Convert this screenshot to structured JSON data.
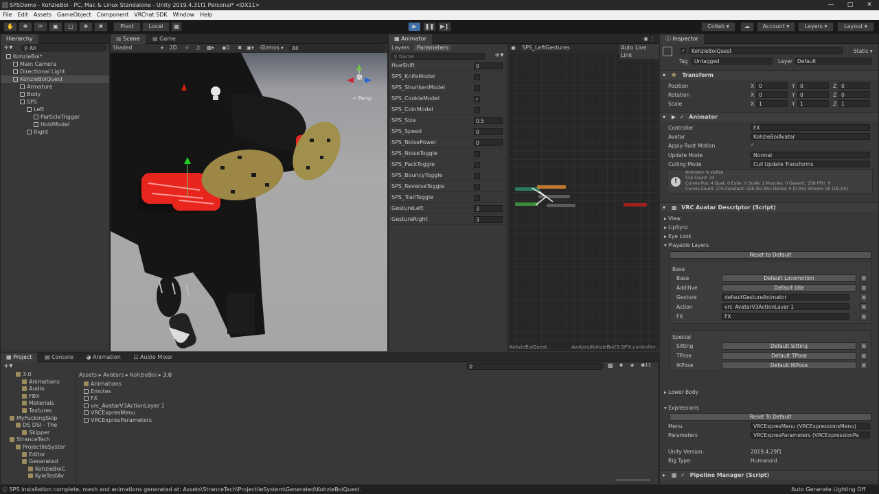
{
  "window": {
    "title": "SPSDemo - KohzieBoi - PC, Mac & Linux Standalone - Unity 2019.4.31f1 Personal* <DX11>"
  },
  "menu": [
    "File",
    "Edit",
    "Assets",
    "GameObject",
    "Component",
    "VRChat SDK",
    "Window",
    "Help"
  ],
  "toolbar": {
    "pivot": "Pivot",
    "local": "Local",
    "collab": "Collab",
    "account": "Account",
    "layers": "Layers",
    "layout": "Layout"
  },
  "hierarchy": {
    "tab": "Hierarchy",
    "search": "All",
    "items": [
      {
        "label": "KohzieBoi*",
        "indent": 0,
        "type": "scene"
      },
      {
        "label": "Main Camera",
        "indent": 1,
        "type": "obj"
      },
      {
        "label": "Directional Light",
        "indent": 1,
        "type": "obj"
      },
      {
        "label": "KohzieBoiQuest",
        "indent": 1,
        "type": "obj",
        "sel": true
      },
      {
        "label": "Armature",
        "indent": 2,
        "type": "obj"
      },
      {
        "label": "Body",
        "indent": 2,
        "type": "obj"
      },
      {
        "label": "SPS",
        "indent": 2,
        "type": "obj"
      },
      {
        "label": "Left",
        "indent": 3,
        "type": "obj"
      },
      {
        "label": "ParticleTrigger",
        "indent": 4,
        "type": "obj"
      },
      {
        "label": "HoldModel",
        "indent": 4,
        "type": "obj"
      },
      {
        "label": "Right",
        "indent": 3,
        "type": "obj"
      }
    ]
  },
  "scene": {
    "tabs": [
      "Scene",
      "Game"
    ],
    "shading": "Shaded",
    "mode2d": "2D",
    "gizmos": "Gizmos",
    "search": "All",
    "persp": "< Persp"
  },
  "animator": {
    "tab": "Animator",
    "subtabs": [
      "Layers",
      "Parameters"
    ],
    "search": "Name",
    "breadcrumb": "SPS_LeftGestures",
    "autolive": "Auto Live Link",
    "footer_left": "KohzieBoiQuest",
    "footer_right": "Avatars/KohzieBoi/3.0/FX.controller",
    "params": [
      {
        "name": "HueShift",
        "value": "0"
      },
      {
        "name": "SPS_KnifeModel",
        "check": ""
      },
      {
        "name": "SPS_ShurikenModel",
        "check": ""
      },
      {
        "name": "SPS_CookieModel",
        "check": "✓"
      },
      {
        "name": "SPS_CoinModel",
        "check": ""
      },
      {
        "name": "SPS_Size",
        "value": "0.5"
      },
      {
        "name": "SPS_Speed",
        "value": "0"
      },
      {
        "name": "SPS_NoisePower",
        "value": "0"
      },
      {
        "name": "SPS_NoiseToggle",
        "check": ""
      },
      {
        "name": "SPS_PackToggle",
        "check": ""
      },
      {
        "name": "SPS_BouncyToggle",
        "check": ""
      },
      {
        "name": "SPS_ReverseToggle",
        "check": ""
      },
      {
        "name": "SPS_TrailToggle",
        "check": ""
      },
      {
        "name": "GestureLeft",
        "value": "3"
      },
      {
        "name": "GestureRight",
        "value": "3"
      }
    ]
  },
  "inspector": {
    "tab": "Inspector",
    "object": "KohzieBoiQuest",
    "static": "Static",
    "tag_label": "Tag",
    "tag": "Untagged",
    "layer_label": "Layer",
    "layer": "Default",
    "transform": {
      "title": "Transform",
      "position": "Position",
      "rotation": "Rotation",
      "scale": "Scale",
      "px": "0",
      "py": "0",
      "pz": "0",
      "rx": "0",
      "ry": "0",
      "rz": "0",
      "sx": "1",
      "sy": "1",
      "sz": "1"
    },
    "animator": {
      "title": "Animator",
      "controller_label": "Controller",
      "controller": "FX",
      "avatar_label": "Avatar",
      "avatar": "KohzieBoiAvatar",
      "root_label": "Apply Root Motion",
      "update_label": "Update Mode",
      "update": "Normal",
      "culling_label": "Culling Mode",
      "culling": "Cull Update Transforms",
      "info1": "Animator is visible",
      "info2": "Clip Count: 23",
      "info3": "Curves Pos: 4 Quat: 0 Euler: 0 Scale: 2 Muscles: 0 Generic: 258 PPtr: 0",
      "info4": "Curves Count: 276 Constant: 226 (81.9%) Dense: 0 (0.0%) Stream: 50 (18.1%)"
    },
    "descriptor": {
      "title": "VRC Avatar Descriptor (Script)",
      "view": "View",
      "lipsync": "LipSync",
      "eyelook": "Eye Look",
      "playable": "Playable Layers",
      "reset": "Reset to Default",
      "base_hdr": "Base",
      "base": [
        {
          "label": "Base",
          "value": "Default Locomotion",
          "btn": true
        },
        {
          "label": "Additive",
          "value": "Default Idle",
          "btn": true
        },
        {
          "label": "Gesture",
          "value": "defaultGestureAnimator",
          "btn": false
        },
        {
          "label": "Action",
          "value": "vrc_AvatarV3ActionLayer 1",
          "btn": false
        },
        {
          "label": "FX",
          "value": "FX",
          "btn": false
        }
      ],
      "special_hdr": "Special",
      "special": [
        {
          "label": "Sitting",
          "value": "Default Sitting"
        },
        {
          "label": "TPose",
          "value": "Default TPose"
        },
        {
          "label": "IKPose",
          "value": "Default IKPose"
        }
      ],
      "lowerbody": "Lower Body",
      "expressions": "Expressions",
      "reset2": "Reset To Default",
      "menu_label": "Menu",
      "menu": "VRCExpresMenu (VRCExpressionsMenu)",
      "params_label": "Parameters",
      "params": "VRCExpresParameters (VRCExpressionPa",
      "unity_label": "Unity Version:",
      "unity": "2019.4.29f1",
      "rig_label": "Rig Type:",
      "rig": "Humanoid"
    },
    "pipeline": "Pipeline Manager (Script)"
  },
  "project": {
    "tabs": [
      "Project",
      "Console",
      "Animation",
      "Audio Mixer"
    ],
    "tree": [
      {
        "label": "3.0",
        "indent": 2
      },
      {
        "label": "Animations",
        "indent": 3
      },
      {
        "label": "Audio",
        "indent": 3
      },
      {
        "label": "FBX",
        "indent": 3
      },
      {
        "label": "Materials",
        "indent": 3
      },
      {
        "label": "Textures",
        "indent": 3
      },
      {
        "label": "MyFuckingSkip",
        "indent": 1
      },
      {
        "label": "DS DSI - The",
        "indent": 2
      },
      {
        "label": "Skipper",
        "indent": 3
      },
      {
        "label": "StranceTech",
        "indent": 1
      },
      {
        "label": "ProjectileSyster",
        "indent": 2
      },
      {
        "label": "Editor",
        "indent": 3
      },
      {
        "label": "Generated",
        "indent": 3
      },
      {
        "label": "KohzieBoiC",
        "indent": 4
      },
      {
        "label": "KyleTestAv",
        "indent": 4
      }
    ],
    "breadcrumb": [
      "Assets",
      "Avatars",
      "KohzieBoi",
      "3.0"
    ],
    "files": [
      "Animations",
      "Emotes",
      "FX",
      "vrc_AvatarV3ActionLayer 1",
      "VRCExpresMenu",
      "VRCExpresParameters"
    ],
    "count": "11"
  },
  "status": {
    "message": "SPS installation complete, mesh and animations generated at: Assets\\StranceTech\\ProjectileSystem\\Generated\\KohzieBoiQuest.",
    "right": "Auto Generate Lighting Off"
  }
}
